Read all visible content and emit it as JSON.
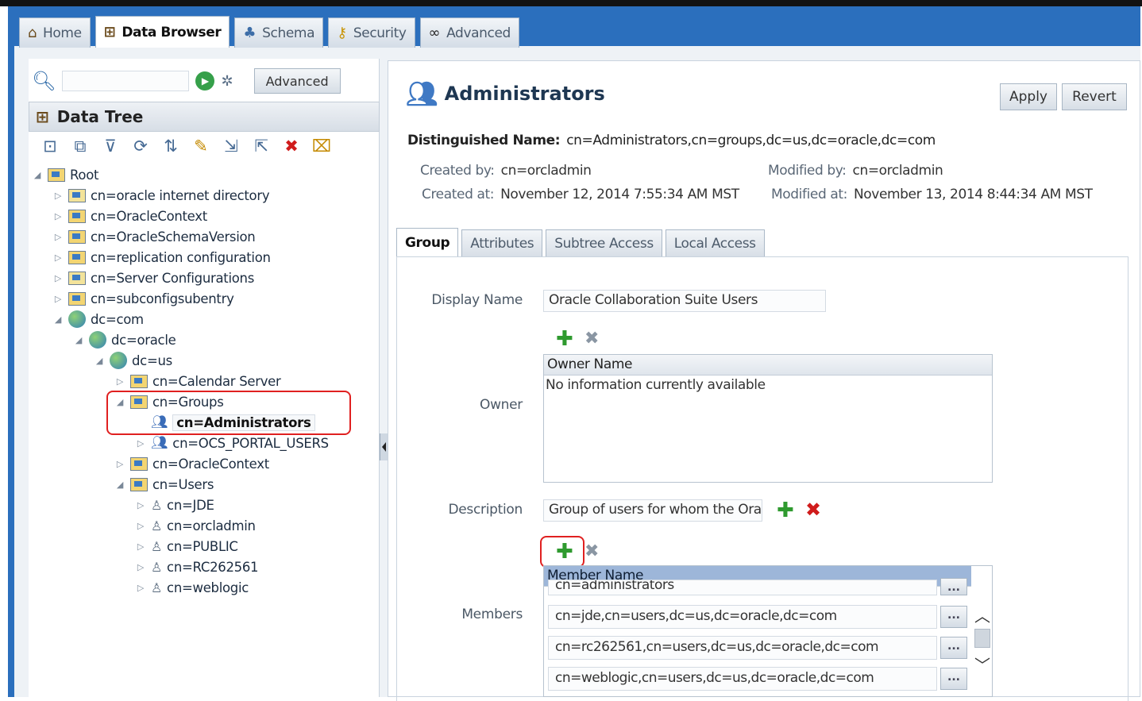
{
  "tabs": [
    {
      "label": "Home",
      "icon": "home-icon"
    },
    {
      "label": "Data Browser",
      "icon": "data-tree-icon"
    },
    {
      "label": "Schema",
      "icon": "schema-icon"
    },
    {
      "label": "Security",
      "icon": "security-icon"
    },
    {
      "label": "Advanced",
      "icon": "glasses-icon"
    }
  ],
  "left": {
    "search_value": "",
    "advanced_label": "Advanced",
    "tree_title": "Data Tree",
    "nodes": [
      {
        "label": "Root"
      },
      {
        "label": "cn=oracle internet directory"
      },
      {
        "label": "cn=OracleContext"
      },
      {
        "label": "cn=OracleSchemaVersion"
      },
      {
        "label": "cn=replication configuration"
      },
      {
        "label": "cn=Server Configurations"
      },
      {
        "label": "cn=subconfigsubentry"
      },
      {
        "label": "dc=com"
      },
      {
        "label": "dc=oracle"
      },
      {
        "label": "dc=us"
      },
      {
        "label": "cn=Calendar Server"
      },
      {
        "label": "cn=Groups"
      },
      {
        "label": "cn=Administrators"
      },
      {
        "label": "cn=OCS_PORTAL_USERS"
      },
      {
        "label": "cn=OracleContext"
      },
      {
        "label": "cn=Users"
      },
      {
        "label": "cn=JDE"
      },
      {
        "label": "cn=orcladmin"
      },
      {
        "label": "cn=PUBLIC"
      },
      {
        "label": "cn=RC262561"
      },
      {
        "label": "cn=weblogic"
      }
    ]
  },
  "entry": {
    "title": "Administrators",
    "apply_label": "Apply",
    "revert_label": "Revert",
    "dn_label": "Distinguished Name:",
    "dn_value": "cn=Administrators,cn=groups,dc=us,dc=oracle,dc=com",
    "created_by_label": "Created by:",
    "created_by": "cn=orcladmin",
    "created_at_label": "Created at:",
    "created_at": "November 12, 2014 7:55:34 AM MST",
    "modified_by_label": "Modified by:",
    "modified_by": "cn=orcladmin",
    "modified_at_label": "Modified at:",
    "modified_at": "November 13, 2014 8:44:34 AM MST",
    "detail_tabs": [
      "Group",
      "Attributes",
      "Subtree Access",
      "Local Access"
    ],
    "display_name_label": "Display Name",
    "display_name": "Oracle Collaboration Suite Users",
    "owner_label": "Owner",
    "owner_col": "Owner Name",
    "owner_empty": "No information currently available",
    "description_label": "Description",
    "description": "Group of users for whom the Orac",
    "members_label": "Members",
    "members_col": "Member Name",
    "members": [
      "cn=administrators",
      "cn=jde,cn=users,dc=us,dc=oracle,dc=com",
      "cn=rc262561,cn=users,dc=us,dc=oracle,dc=com",
      "cn=weblogic,cn=users,dc=us,dc=oracle,dc=com"
    ],
    "dots_label": "..."
  }
}
